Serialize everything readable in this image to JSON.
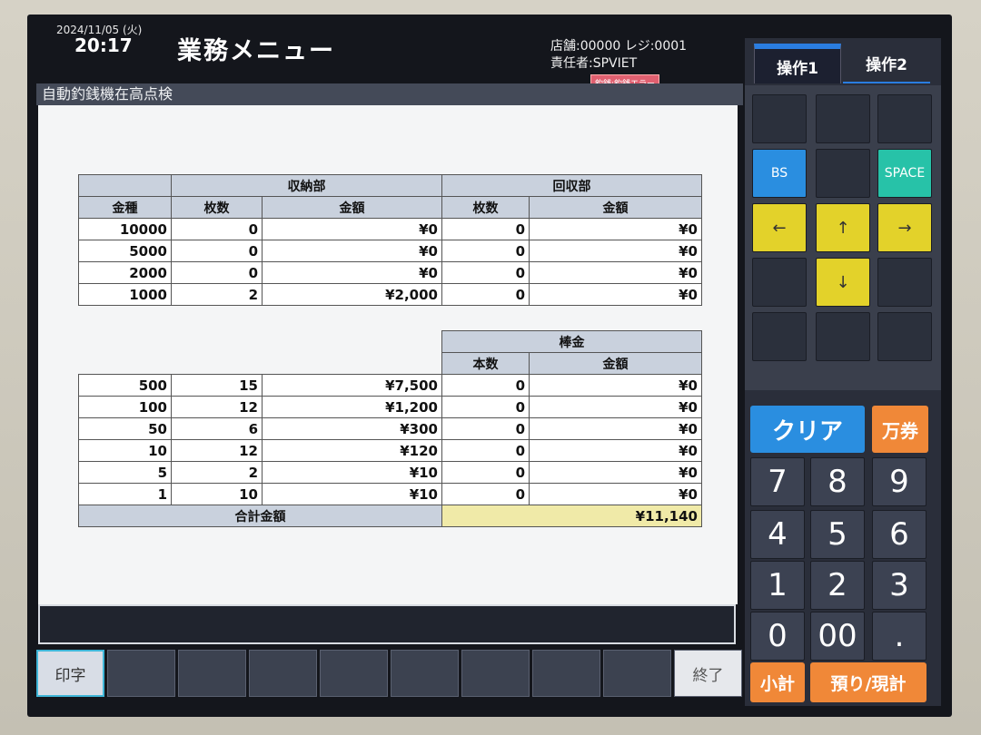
{
  "header": {
    "date": "2024/11/05 (火)",
    "time": "20:17",
    "title": "業務メニュー",
    "store": "店舗:00000 レジ:0001",
    "manager": "責任者:SPVIET",
    "error_badge": "釣銭:釣銭エラー"
  },
  "panel": {
    "title": "自動釣銭機在高点検"
  },
  "table": {
    "headers": {
      "denomination": "金種",
      "storage": "収納部",
      "recovery": "回収部",
      "bar": "棒金",
      "count": "枚数",
      "amount": "金額",
      "bar_count": "本数",
      "total": "合計金額"
    },
    "bills": [
      {
        "denom": "10000",
        "count": "0",
        "amount": "¥0",
        "r_count": "0",
        "r_amount": "¥0"
      },
      {
        "denom": "5000",
        "count": "0",
        "amount": "¥0",
        "r_count": "0",
        "r_amount": "¥0"
      },
      {
        "denom": "2000",
        "count": "0",
        "amount": "¥0",
        "r_count": "0",
        "r_amount": "¥0"
      },
      {
        "denom": "1000",
        "count": "2",
        "amount": "¥2,000",
        "r_count": "0",
        "r_amount": "¥0"
      }
    ],
    "coins": [
      {
        "denom": "500",
        "count": "15",
        "amount": "¥7,500",
        "b_count": "0",
        "b_amount": "¥0"
      },
      {
        "denom": "100",
        "count": "12",
        "amount": "¥1,200",
        "b_count": "0",
        "b_amount": "¥0"
      },
      {
        "denom": "50",
        "count": "6",
        "amount": "¥300",
        "b_count": "0",
        "b_amount": "¥0"
      },
      {
        "denom": "10",
        "count": "12",
        "amount": "¥120",
        "b_count": "0",
        "b_amount": "¥0"
      },
      {
        "denom": "5",
        "count": "2",
        "amount": "¥10",
        "b_count": "0",
        "b_amount": "¥0"
      },
      {
        "denom": "1",
        "count": "10",
        "amount": "¥10",
        "b_count": "0",
        "b_amount": "¥0"
      }
    ],
    "total_value": "¥11,140"
  },
  "function_keys": {
    "print": "印字",
    "end": "終了"
  },
  "right_panel": {
    "tab1": "操作1",
    "tab2": "操作2",
    "bs": "BS",
    "space": "SPACE",
    "left": "←",
    "up": "↑",
    "right": "→",
    "down": "↓",
    "clear": "クリア",
    "manken": "万券",
    "digits": [
      "7",
      "8",
      "9",
      "4",
      "5",
      "6",
      "1",
      "2",
      "3",
      "0",
      "00",
      "."
    ],
    "subtotal": "小計",
    "deposit": "預り/現計"
  }
}
